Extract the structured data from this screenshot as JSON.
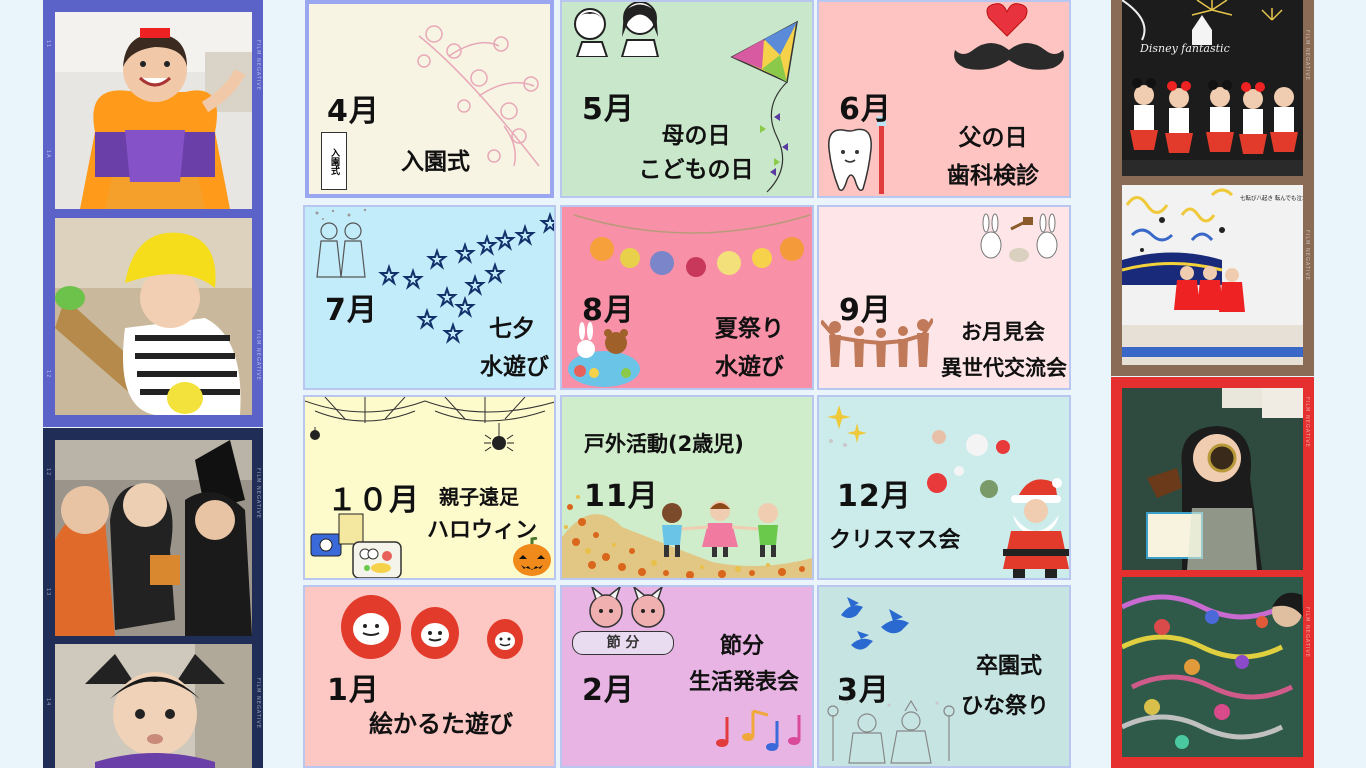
{
  "left_film_top": {
    "label": "FILM NEGATIVE",
    "frame_numbers": [
      "11",
      "1A",
      "12"
    ]
  },
  "left_film_bottom": {
    "label": "FILM NEGATIVE",
    "frame_numbers": [
      "12",
      "13",
      "14"
    ]
  },
  "right_film_top": {
    "label": "FILM NEGATIVE"
  },
  "right_film_bottom": {
    "label": "FILM NEGATIVE"
  },
  "photo_signs": {
    "theater_banner": "Disney fantastic",
    "poster_text": "七転び八起き 転んでも泣かない ダルマだもん"
  },
  "months": [
    {
      "month": "4月",
      "lines": [
        "入園式"
      ],
      "deco_label": "入園式"
    },
    {
      "month": "5月",
      "lines": [
        "母の日",
        "こどもの日"
      ]
    },
    {
      "month": "6月",
      "lines": [
        "父の日",
        "歯科検診"
      ]
    },
    {
      "month": "7月",
      "lines": [
        "七夕",
        "水遊び"
      ]
    },
    {
      "month": "8月",
      "lines": [
        "夏祭り",
        "水遊び"
      ]
    },
    {
      "month": "9月",
      "lines": [
        "お月見会",
        "異世代交流会"
      ]
    },
    {
      "month": "１０月",
      "lines": [
        "親子遠足",
        "ハロウィン"
      ]
    },
    {
      "month": "11月",
      "lines": [
        "戸外活動(2歳児)"
      ]
    },
    {
      "month": "12月",
      "lines": [
        "クリスマス会"
      ]
    },
    {
      "month": "1月",
      "lines": [
        "絵かるた遊び"
      ]
    },
    {
      "month": "2月",
      "lines": [
        "節分",
        "生活発表会"
      ],
      "deco_label": "節 分"
    },
    {
      "month": "3月",
      "lines": [
        "卒園式",
        "ひな祭り"
      ]
    }
  ],
  "colors": {
    "page_bg": "#e9f4fb",
    "cell_border": "#b9c6f0",
    "film_left_top": "#5b63c9",
    "film_left_bottom": "#1f2d57",
    "film_right_top": "#8a6b55",
    "film_right_bottom": "#e5302f"
  }
}
